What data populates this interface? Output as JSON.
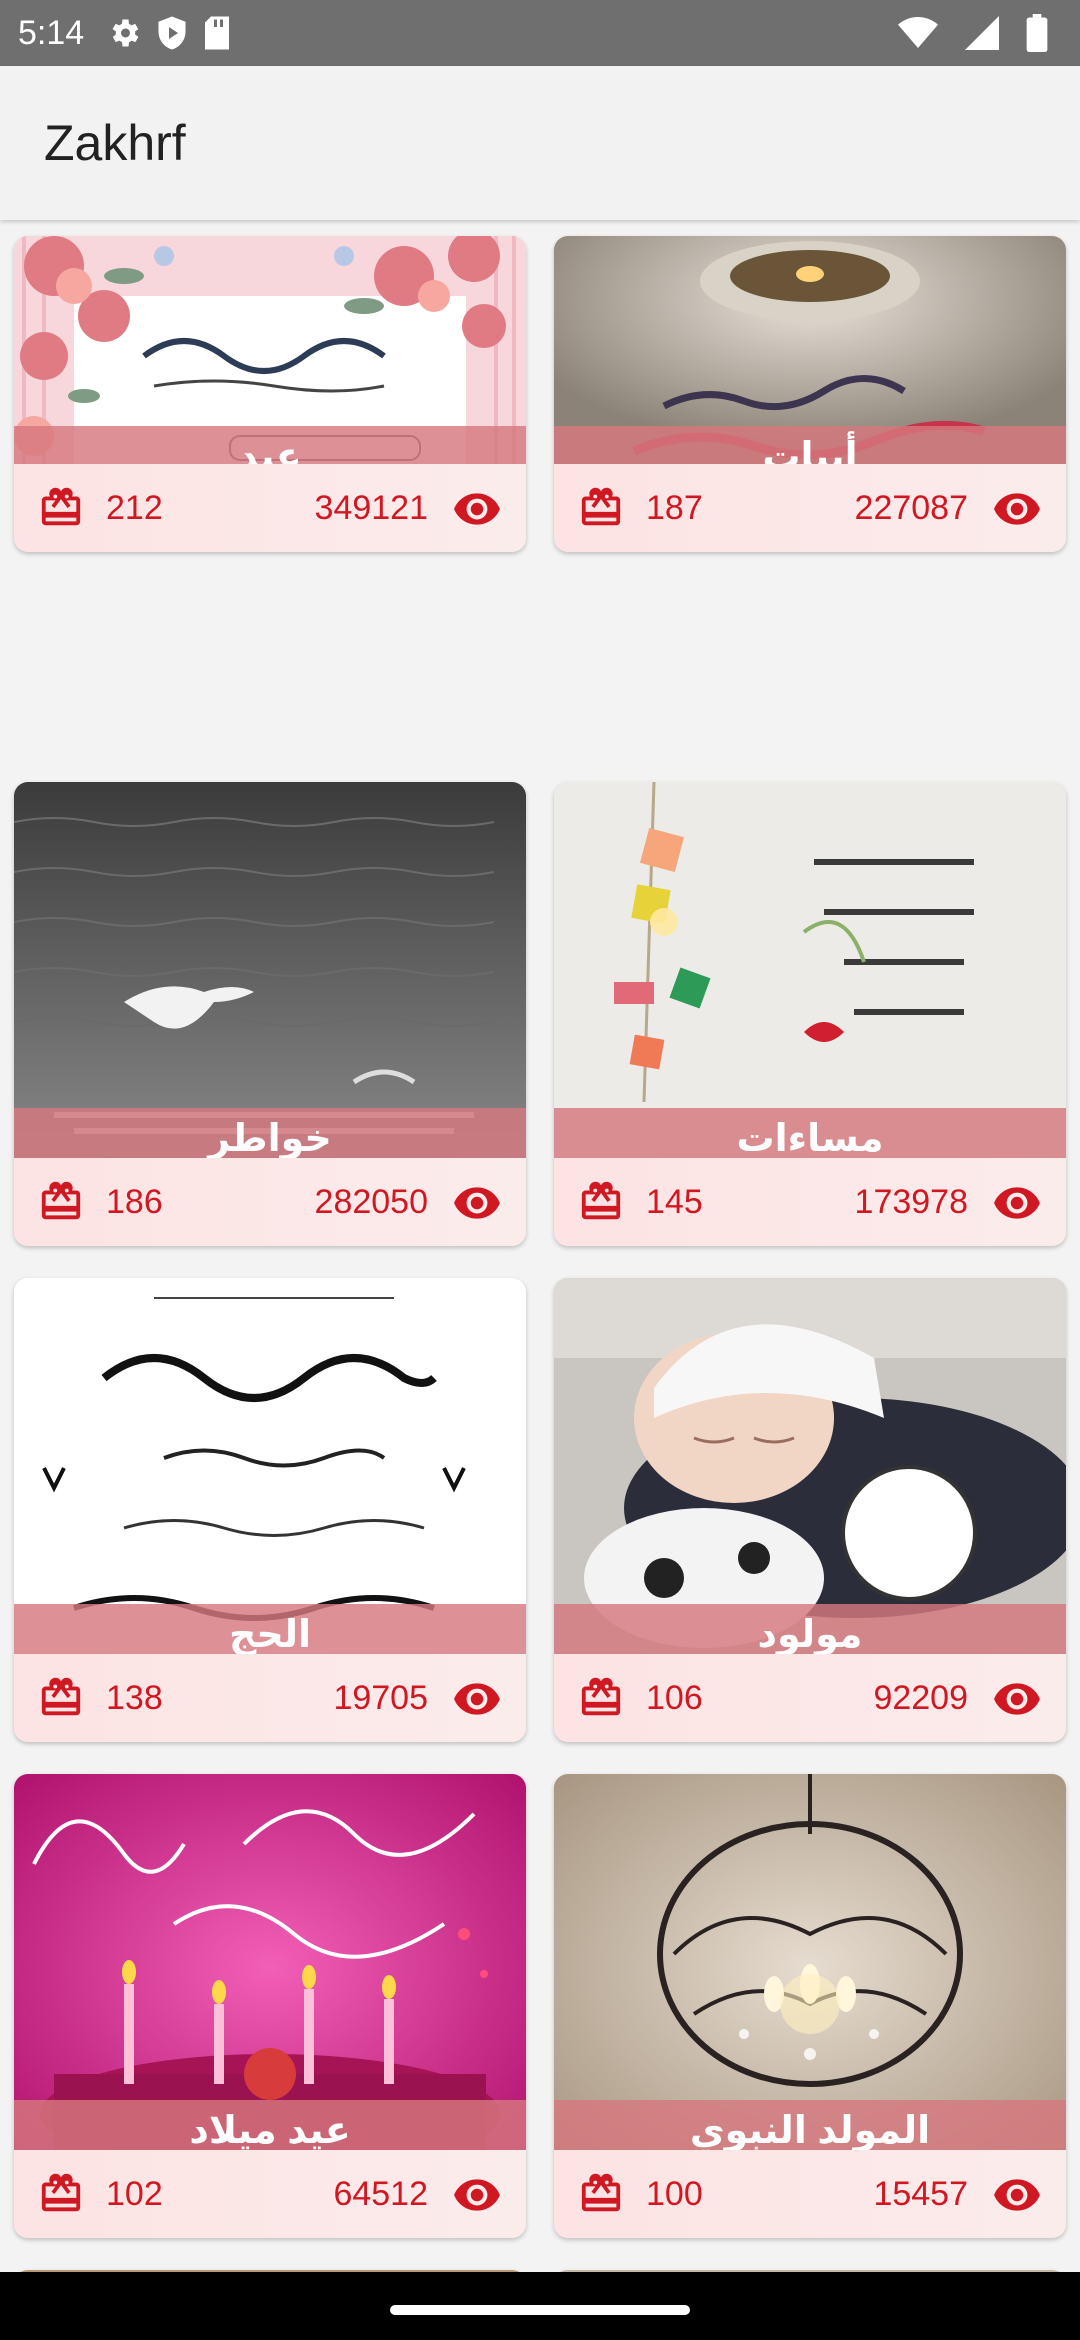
{
  "status_bar": {
    "time": "5:14",
    "icons": [
      "gear-icon",
      "shield-play-icon",
      "sd-card-icon",
      "wifi-icon",
      "signal-icon",
      "battery-icon"
    ]
  },
  "app_bar": {
    "title": "Zakhrf"
  },
  "colors": {
    "accent": "#d01822",
    "label_band": "#d6787e",
    "card_footer": "#fde3e3"
  },
  "cards": [
    {
      "label": "عيد",
      "likes": "212",
      "views": "349121",
      "image": "floral-greeting-card"
    },
    {
      "label": "أبيات",
      "likes": "187",
      "views": "227087",
      "image": "candle-on-fabric"
    },
    {
      "label": "خواطر",
      "likes": "186",
      "views": "282050",
      "image": "seagull-over-sea"
    },
    {
      "label": "مساءات",
      "likes": "145",
      "views": "173978",
      "image": "lanterns-calligraphy"
    },
    {
      "label": "الحج",
      "likes": "138",
      "views": "19705",
      "image": "prayer-calligraphy"
    },
    {
      "label": "مولود",
      "likes": "106",
      "views": "92209",
      "image": "sleeping-baby"
    },
    {
      "label": "عيد ميلاد",
      "likes": "102",
      "views": "64512",
      "image": "birthday-cake"
    },
    {
      "label": "المولد النبوي",
      "likes": "100",
      "views": "15457",
      "image": "crystal-chandelier"
    }
  ]
}
